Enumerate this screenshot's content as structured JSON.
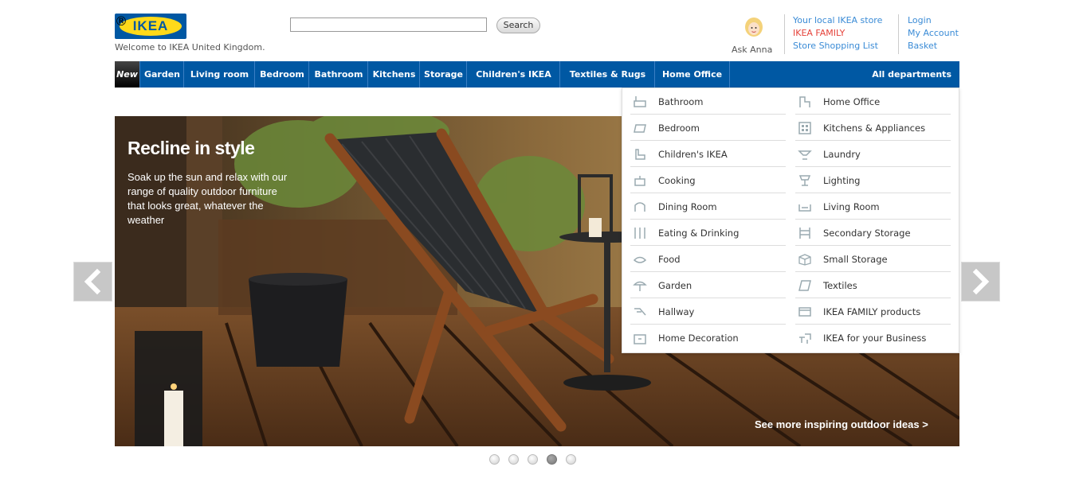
{
  "header": {
    "logo_text": "IKEA",
    "logo_reg": "®",
    "welcome": "Welcome to IKEA United Kingdom.",
    "search_placeholder": "",
    "search_button": "Search",
    "ask_anna": "Ask Anna",
    "links_col1": [
      "Your local IKEA store",
      "IKEA FAMILY",
      "Store Shopping List"
    ],
    "links_col2": [
      "Login",
      "My Account",
      "Basket"
    ]
  },
  "nav": {
    "new_label": "New",
    "items": [
      "Garden",
      "Living room",
      "Bedroom",
      "Bathroom",
      "Kitchens",
      "Storage",
      "Children's IKEA",
      "Textiles & Rugs",
      "Home Office"
    ],
    "all_departments": "All departments"
  },
  "dropdown": {
    "left": [
      {
        "label": "Bathroom",
        "icon": "bathroom-icon"
      },
      {
        "label": "Bedroom",
        "icon": "bedroom-icon"
      },
      {
        "label": "Children's IKEA",
        "icon": "children-icon"
      },
      {
        "label": "Cooking",
        "icon": "cooking-icon"
      },
      {
        "label": "Dining Room",
        "icon": "dining-icon"
      },
      {
        "label": "Eating & Drinking",
        "icon": "cutlery-icon"
      },
      {
        "label": "Food",
        "icon": "food-icon"
      },
      {
        "label": "Garden",
        "icon": "garden-icon"
      },
      {
        "label": "Hallway",
        "icon": "hallway-icon"
      },
      {
        "label": "Home Decoration",
        "icon": "decoration-icon"
      }
    ],
    "right": [
      {
        "label": "Home Office",
        "icon": "office-icon"
      },
      {
        "label": "Kitchens & Appliances",
        "icon": "kitchen-icon"
      },
      {
        "label": "Laundry",
        "icon": "laundry-icon"
      },
      {
        "label": "Lighting",
        "icon": "lamp-icon"
      },
      {
        "label": "Living Room",
        "icon": "sofa-icon"
      },
      {
        "label": "Secondary Storage",
        "icon": "shelf-icon"
      },
      {
        "label": "Small Storage",
        "icon": "box-icon"
      },
      {
        "label": "Textiles",
        "icon": "textile-icon"
      },
      {
        "label": "IKEA FAMILY products",
        "icon": "card-icon"
      },
      {
        "label": "IKEA for your Business",
        "icon": "business-icon"
      }
    ]
  },
  "hero": {
    "title": "Recline in style",
    "body": "Soak up the sun and relax with our range of quality outdoor furniture that looks great, whatever the weather",
    "more_link": "See more inspiring outdoor ideas >"
  },
  "carousel": {
    "slide_count": 5,
    "active_index": 3
  },
  "colors": {
    "brand_blue": "#0058a3",
    "brand_yellow": "#ffda1a",
    "link_blue": "#3a8bd6",
    "family_red": "#e5423a"
  }
}
